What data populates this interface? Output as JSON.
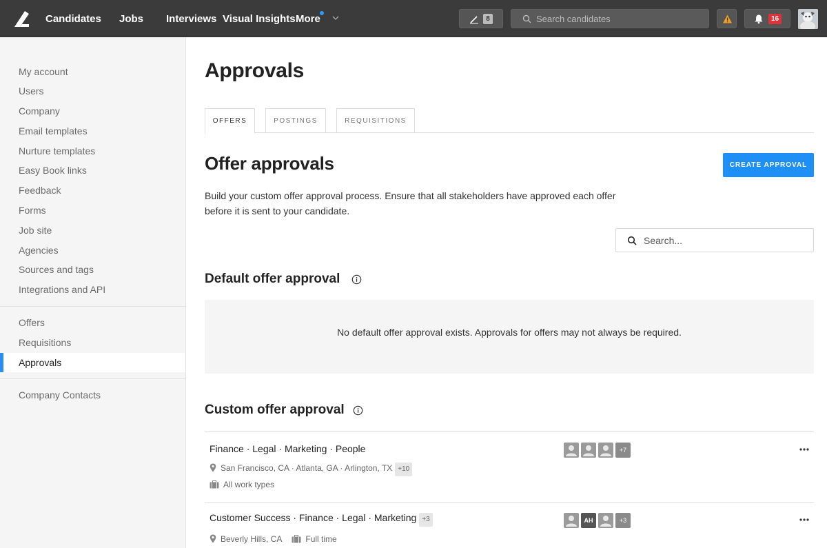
{
  "nav": {
    "links": [
      "Candidates",
      "Jobs",
      "Interviews",
      "Visual Insights",
      "More"
    ],
    "pen_count": "8",
    "search_placeholder": "Search candidates",
    "notification_count": "16"
  },
  "sidebar": {
    "group1": [
      "My account",
      "Users",
      "Company",
      "Email templates",
      "Nurture templates",
      "Easy Book links",
      "Feedback",
      "Forms",
      "Job site",
      "Agencies",
      "Sources and tags",
      "Integrations and API"
    ],
    "group2": [
      "Offers",
      "Requisitions",
      "Approvals"
    ],
    "group3": [
      "Company Contacts"
    ],
    "active": "Approvals"
  },
  "main": {
    "title": "Approvals",
    "tabs": [
      "OFFERS",
      "POSTINGS",
      "REQUISITIONS"
    ],
    "section_title": "Offer approvals",
    "create_button": "CREATE APPROVAL",
    "description_line1": "Build your custom offer approval process. Ensure that all stakeholders have approved each offer",
    "description_line2": "before it is sent to your candidate.",
    "search_placeholder": "Search...",
    "default_title": "Default offer approval",
    "default_empty": "No default offer approval exists. Approvals for offers may not always be required.",
    "custom_title": "Custom offer approval",
    "rows": [
      {
        "title": "Finance · Legal · Marketing · People",
        "title_extra": "",
        "location": "San Francisco, CA · Atlanta, GA · Arlington, TX",
        "location_extra": "+10",
        "work_type": "All work types",
        "avatars": [
          "",
          "",
          ""
        ],
        "avatars_more": "+7"
      },
      {
        "title": "Customer Success · Finance · Legal · Marketing",
        "title_extra": "+3",
        "location": "Beverly Hills, CA",
        "location_extra": "",
        "work_type": "Full time",
        "avatars": [
          "",
          "AH",
          ""
        ],
        "avatars_more": "+3"
      }
    ]
  }
}
